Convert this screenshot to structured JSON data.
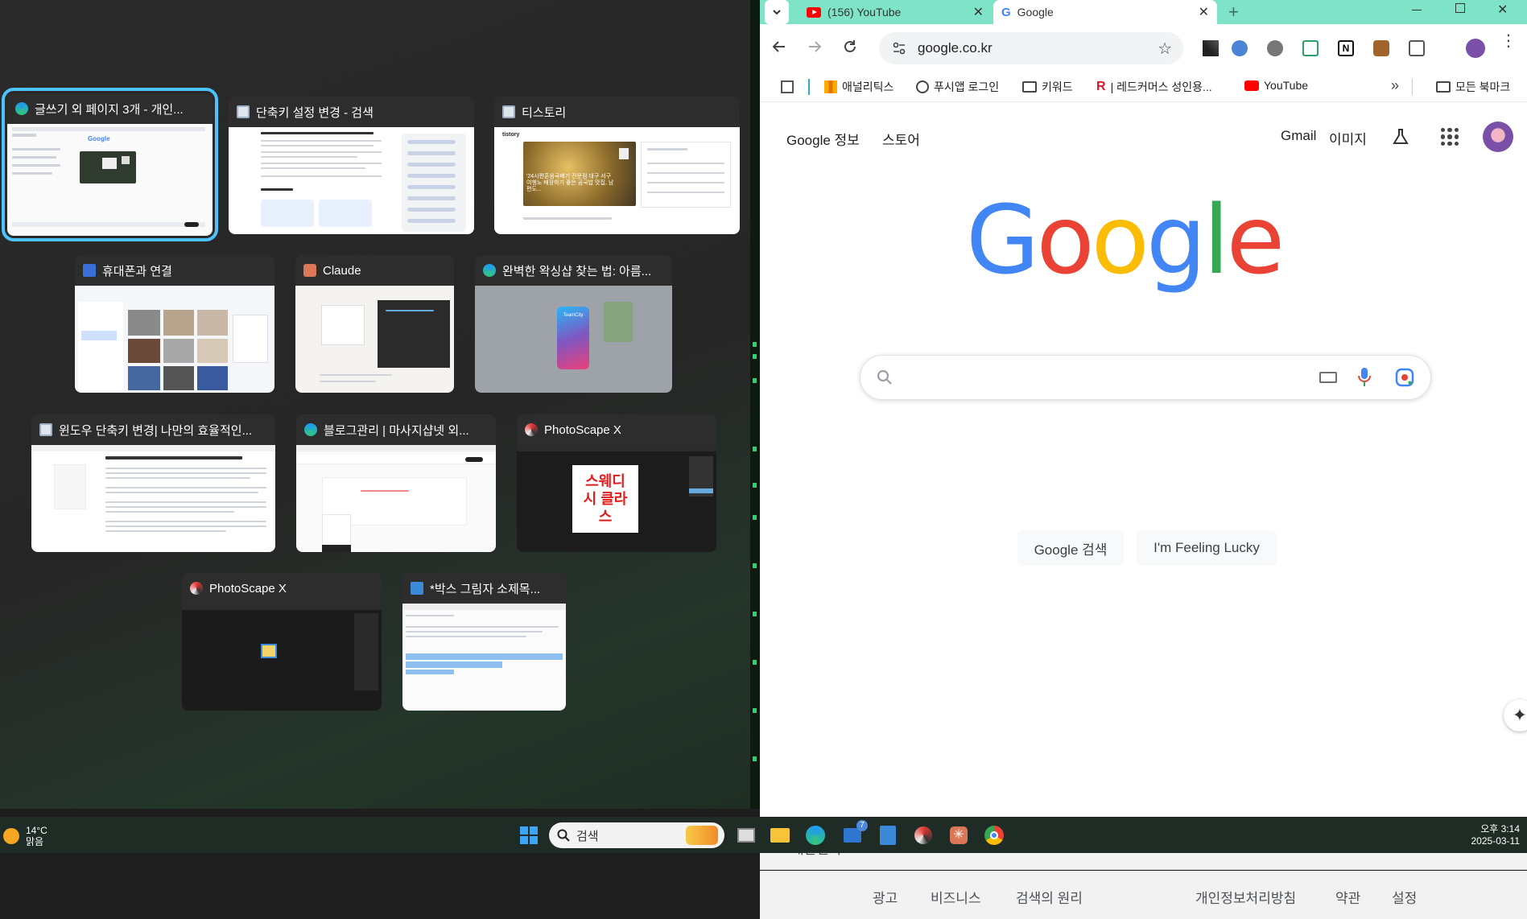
{
  "task_switcher": {
    "windows": [
      {
        "title": "글쓰기 외 페이지 3개 - 개인...",
        "app": "edge"
      },
      {
        "title": "단축키 설정 변경 - 검색",
        "app": "explorer"
      },
      {
        "title": "티스토리",
        "app": "explorer"
      },
      {
        "title": "휴대폰과 연결",
        "app": "phone-link"
      },
      {
        "title": "Claude",
        "app": "claude"
      },
      {
        "title": "완벽한 왁싱샵 찾는 법: 아름...",
        "app": "edge"
      },
      {
        "title": "윈도우 단축키 변경| 나만의 효율적인...",
        "app": "explorer"
      },
      {
        "title": "블로그관리 | 마사지샵넷 외...",
        "app": "edge"
      },
      {
        "title": "PhotoScape X",
        "app": "photoscape"
      },
      {
        "title": "PhotoScape X",
        "app": "photoscape"
      },
      {
        "title": "*박스 그림자 소제목...",
        "app": "notepad"
      }
    ],
    "thumb_texts": {
      "tistory_caption": "'24시편혼음국베기 전문점 대구 서구 여행노 배장하기 좋은 곰국밥 맛집, 남편도...",
      "photoscape_logo": "스웨디시 클라스",
      "teamcity": "TeamCity"
    }
  },
  "browser": {
    "tabs": [
      {
        "label": "(156) YouTube",
        "active": false
      },
      {
        "label": "Google",
        "active": true
      }
    ],
    "url": "google.co.kr",
    "bookmarks": [
      {
        "label": "애널리틱스",
        "icon": "analytics-icon"
      },
      {
        "label": "푸시앱 로그인",
        "icon": "globe-icon"
      },
      {
        "label": "키워드",
        "icon": "folder-icon"
      },
      {
        "label": "| 레드커머스 성인용...",
        "icon": "redcommerce-icon"
      },
      {
        "label": "YouTube",
        "icon": "youtube-icon"
      }
    ],
    "all_bookmarks": "모든 북마크",
    "google": {
      "top_left": [
        "Google 정보",
        "스토어"
      ],
      "top_right": [
        "Gmail",
        "이미지"
      ],
      "logo": [
        "G",
        "o",
        "o",
        "g",
        "l",
        "e"
      ],
      "buttons": [
        "Google 검색",
        "I'm Feeling Lucky"
      ],
      "country": "대한민국",
      "footer_left": [
        "광고",
        "비즈니스",
        "검색의 원리"
      ],
      "footer_right": [
        "개인정보처리방침",
        "약관",
        "설정"
      ],
      "colors": {
        "blue": "#4285f4",
        "red": "#ea4335",
        "yellow": "#fbbc05",
        "green": "#34a853"
      }
    }
  },
  "taskbar": {
    "weather": {
      "temp": "14°C",
      "cond": "맑음"
    },
    "search_placeholder": "검색",
    "mail_badge": "7",
    "time": "오후 3:14",
    "date": "2025-03-11"
  }
}
